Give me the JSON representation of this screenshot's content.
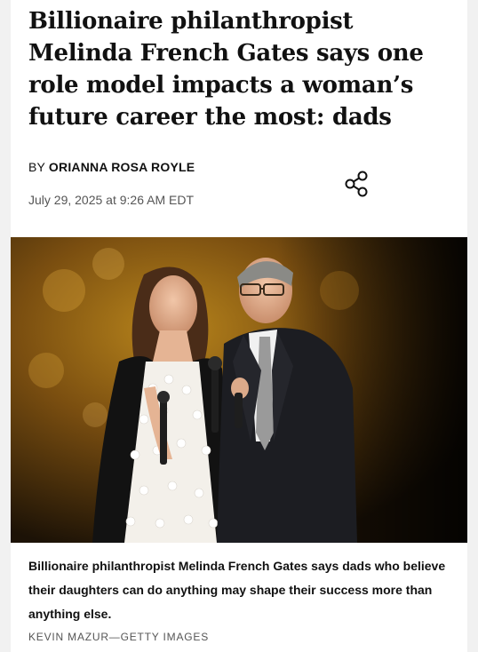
{
  "article": {
    "headline": "Billionaire philanthropist Melinda French Gates says one role model impacts a woman’s future career the most: dads",
    "byline_prefix": "BY",
    "author": "ORIANNA ROSA ROYLE",
    "date": "July 29, 2025 at 9:26 AM EDT",
    "share_icon": "share-icon"
  },
  "photo": {
    "caption": "Billionaire philanthropist Melinda French Gates says dads who believe their daughters can do anything may shape their success more than anything else.",
    "credit": "KEVIN MAZUR—GETTY IMAGES"
  }
}
